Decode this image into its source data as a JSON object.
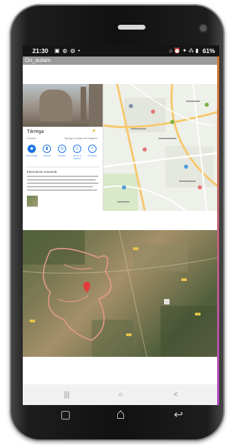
{
  "status_bar": {
    "time": "21:30",
    "notification_icons": "▣ ◍ ◍ •",
    "system_icons": "⌂ ⏰ ✦ ⁂ ▮",
    "battery": "61%"
  },
  "app": {
    "title": "On_autam"
  },
  "place": {
    "name": "Tárrega",
    "type": "Ciudad",
    "right_text": "Tarrega Ciudad de España",
    "actions": [
      {
        "label": "Cómo llegar",
        "icon": "directions-icon"
      },
      {
        "label": "Guardar",
        "icon": "bookmark-icon"
      },
      {
        "label": "Cercano",
        "icon": "nearby-icon"
      },
      {
        "label": "Enviar al teléfono",
        "icon": "phone-icon"
      },
      {
        "label": "Compartir",
        "icon": "share-icon"
      }
    ],
    "info_title": "Información resumida"
  },
  "navigation": {
    "recent_label": "|||",
    "home_label": "○",
    "back_label": "<"
  },
  "hardware": {
    "recent": "▢",
    "home": "⌂",
    "back": "↩"
  },
  "colors": {
    "accent": "#1a73e8",
    "status_bar": "#151515",
    "title_bar": "#9a9a9a",
    "route": "#e69a8d",
    "pin": "#e33b3b"
  }
}
